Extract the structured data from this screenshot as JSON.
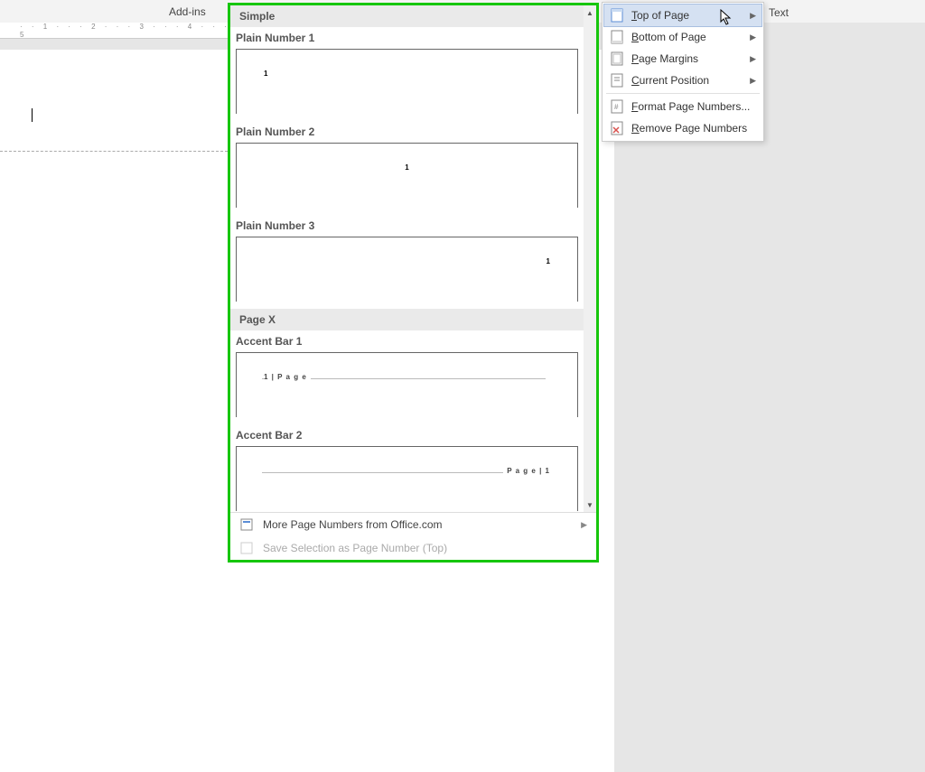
{
  "ribbon": {
    "addins": "Add-ins",
    "text_option": "Text"
  },
  "ruler": {
    "marks": "· · 1 · · · 2 · · · 3 · · · 4 · · · 5"
  },
  "gallery": {
    "group_simple": "Simple",
    "group_pagex": "Page X",
    "items": {
      "plain1_label": "Plain Number 1",
      "plain1_num": "1",
      "plain2_label": "Plain Number 2",
      "plain2_num": "1",
      "plain3_label": "Plain Number 3",
      "plain3_num": "1",
      "accent1_label": "Accent Bar 1",
      "accent1_text": "1 | P a g e",
      "accent2_label": "Accent Bar 2",
      "accent2_text": "P a g e  | 1"
    },
    "footer": {
      "more": "More Page Numbers from Office.com",
      "save_sel": "Save Selection as Page Number (Top)"
    }
  },
  "menu": {
    "top": "Top of Page",
    "bottom": "Bottom of Page",
    "margins": "Page Margins",
    "current": "Current Position",
    "format": "Format Page Numbers...",
    "remove": "Remove Page Numbers"
  }
}
